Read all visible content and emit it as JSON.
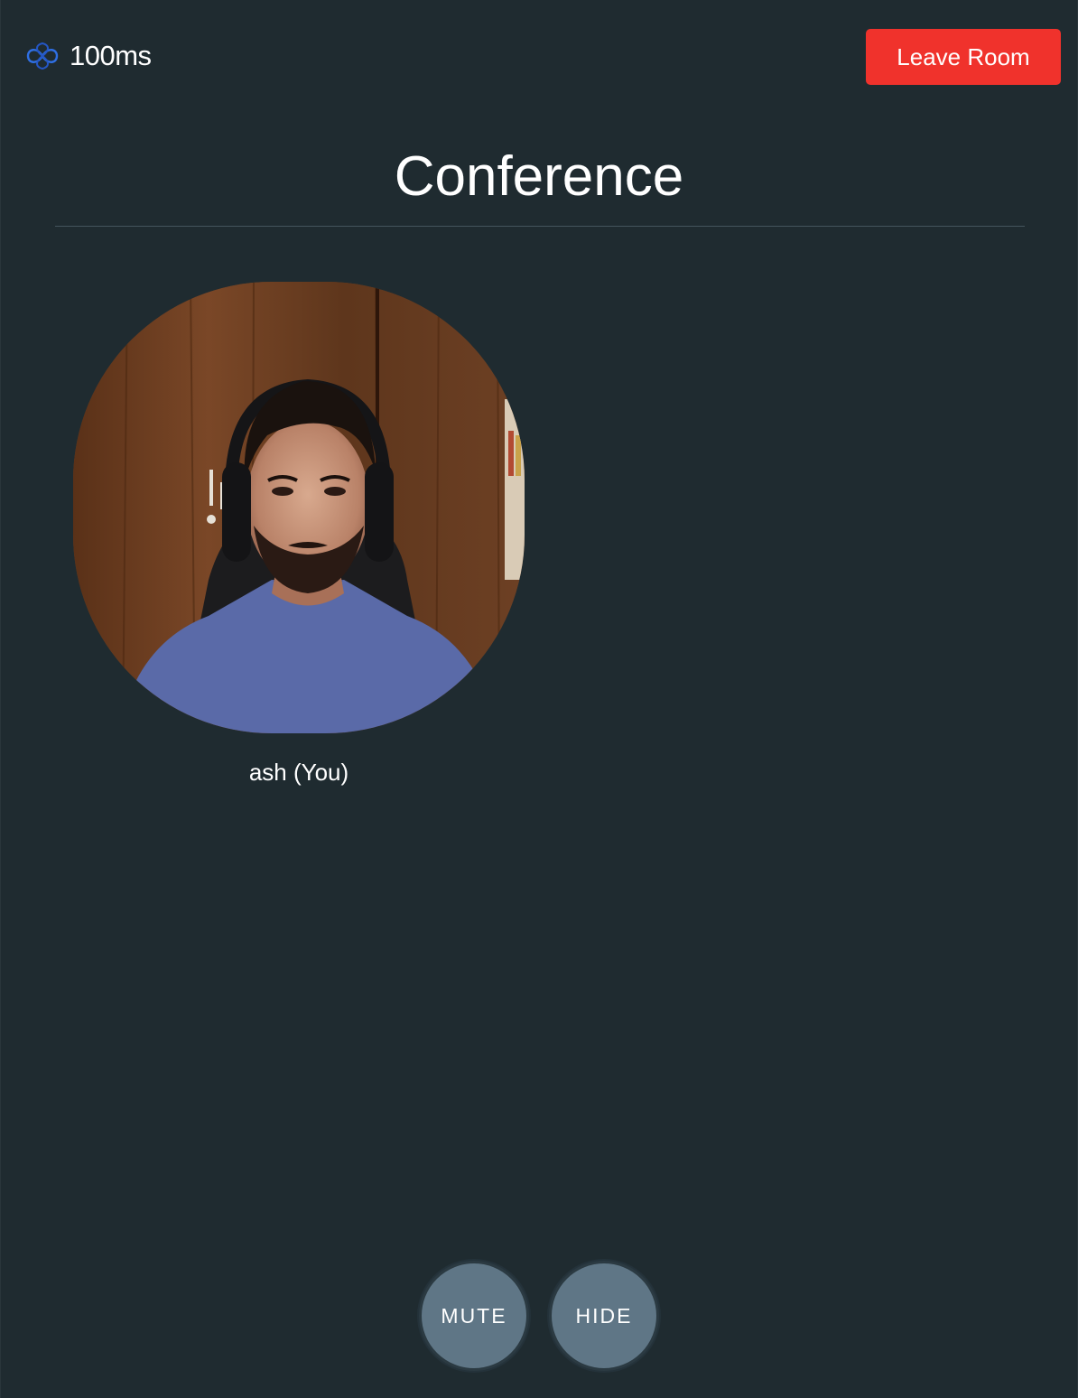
{
  "header": {
    "logo_icon": "infinity-logo-icon",
    "brand_name": "100ms",
    "leave_button_label": "Leave Room"
  },
  "main": {
    "title": "Conference",
    "peers": [
      {
        "name": "ash (You)"
      }
    ]
  },
  "controls": {
    "mute_label": "MUTE",
    "hide_label": "HIDE"
  },
  "colors": {
    "background": "#1f2b30",
    "leave_button": "#f0322c",
    "control_button": "#5f7686",
    "logo_accent": "#2f6fe3"
  }
}
